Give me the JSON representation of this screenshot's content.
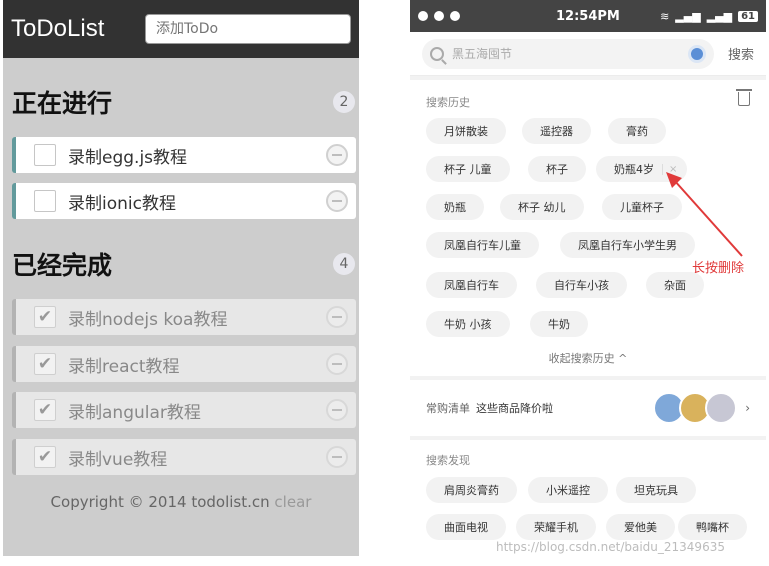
{
  "todo": {
    "title": "ToDoList",
    "input_placeholder": "添加ToDo",
    "in_progress": {
      "title": "正在进行",
      "count": "2",
      "items": [
        "录制egg.js教程",
        "录制ionic教程"
      ]
    },
    "completed": {
      "title": "已经完成",
      "count": "4",
      "items": [
        "录制nodejs koa教程",
        "录制react教程",
        "录制angular教程",
        "录制vue教程"
      ]
    },
    "footer": {
      "copyright": "Copyright © 2014 todolist.cn",
      "clear": "clear"
    }
  },
  "phone": {
    "status": {
      "time": "12:54PM",
      "battery": "61"
    },
    "search": {
      "placeholder": "黑五海囤节",
      "button": "搜索"
    },
    "history": {
      "label": "搜索历史",
      "tags": [
        "月饼散装",
        "遥控器",
        "膏药",
        "杯子 儿童",
        "杯子",
        "奶瓶4岁",
        "奶瓶",
        "杯子 幼儿",
        "儿童杯子",
        "凤凰自行车儿童",
        "凤凰自行车小学生男",
        "凤凰自行车",
        "自行车小孩",
        "杂面",
        "牛奶 小孩",
        "牛奶"
      ],
      "delete_x": "×",
      "collapse": "收起搜索历史 ^"
    },
    "annotation": "长按删除",
    "shopping": {
      "label": "常购清单",
      "text": "这些商品降价啦",
      "chevron": "›"
    },
    "discover": {
      "label": "搜索发现",
      "tags": [
        "肩周炎膏药",
        "小米遥控",
        "坦克玩具",
        "曲面电视",
        "荣耀手机",
        "爱他美",
        "鸭嘴杯"
      ]
    },
    "watermark": "https://blog.csdn.net/baidu_21349635"
  },
  "colors": {
    "todo_header_bg": "#323232",
    "todo_body_bg": "#cdcdcd",
    "active_accent": "#629a9c",
    "annotation_red": "#e03a3a"
  }
}
